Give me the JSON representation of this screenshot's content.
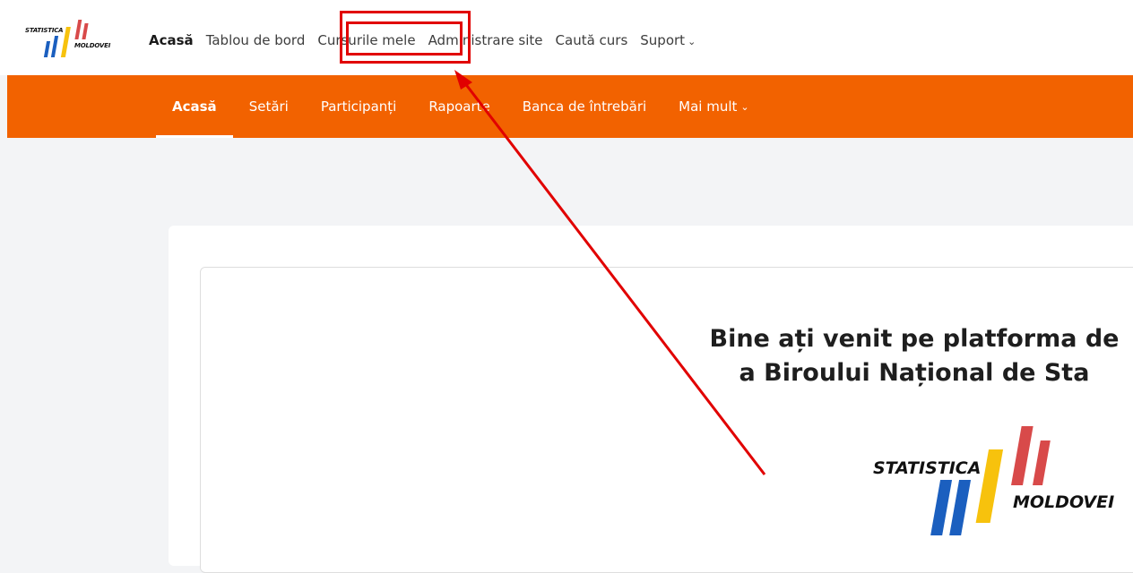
{
  "logo": {
    "line1": "STATISTICA",
    "line2": "MOLDOVEI"
  },
  "primary_nav": [
    {
      "label": "Acasă",
      "active": true
    },
    {
      "label": "Tablou de bord"
    },
    {
      "label": "Cursurile mele"
    },
    {
      "label": "Administrare site"
    },
    {
      "label": "Caută curs"
    },
    {
      "label": "Suport",
      "has_dropdown": true
    }
  ],
  "secondary_nav": [
    {
      "label": "Acasă",
      "active": true
    },
    {
      "label": "Setări"
    },
    {
      "label": "Participanți"
    },
    {
      "label": "Rapoarte"
    },
    {
      "label": "Banca de întrebări"
    },
    {
      "label": "Mai mult",
      "has_dropdown": true
    }
  ],
  "welcome": {
    "line1": "Bine ați venit pe platforma de",
    "line2": "a Biroului Național de Sta"
  },
  "big_logo": {
    "line1": "STATISTICA",
    "line2": "MOLDOVEI"
  },
  "icons": {
    "chevron": "chevron-down-icon"
  },
  "colors": {
    "accent": "#f26200",
    "annotation": "#e10000"
  }
}
